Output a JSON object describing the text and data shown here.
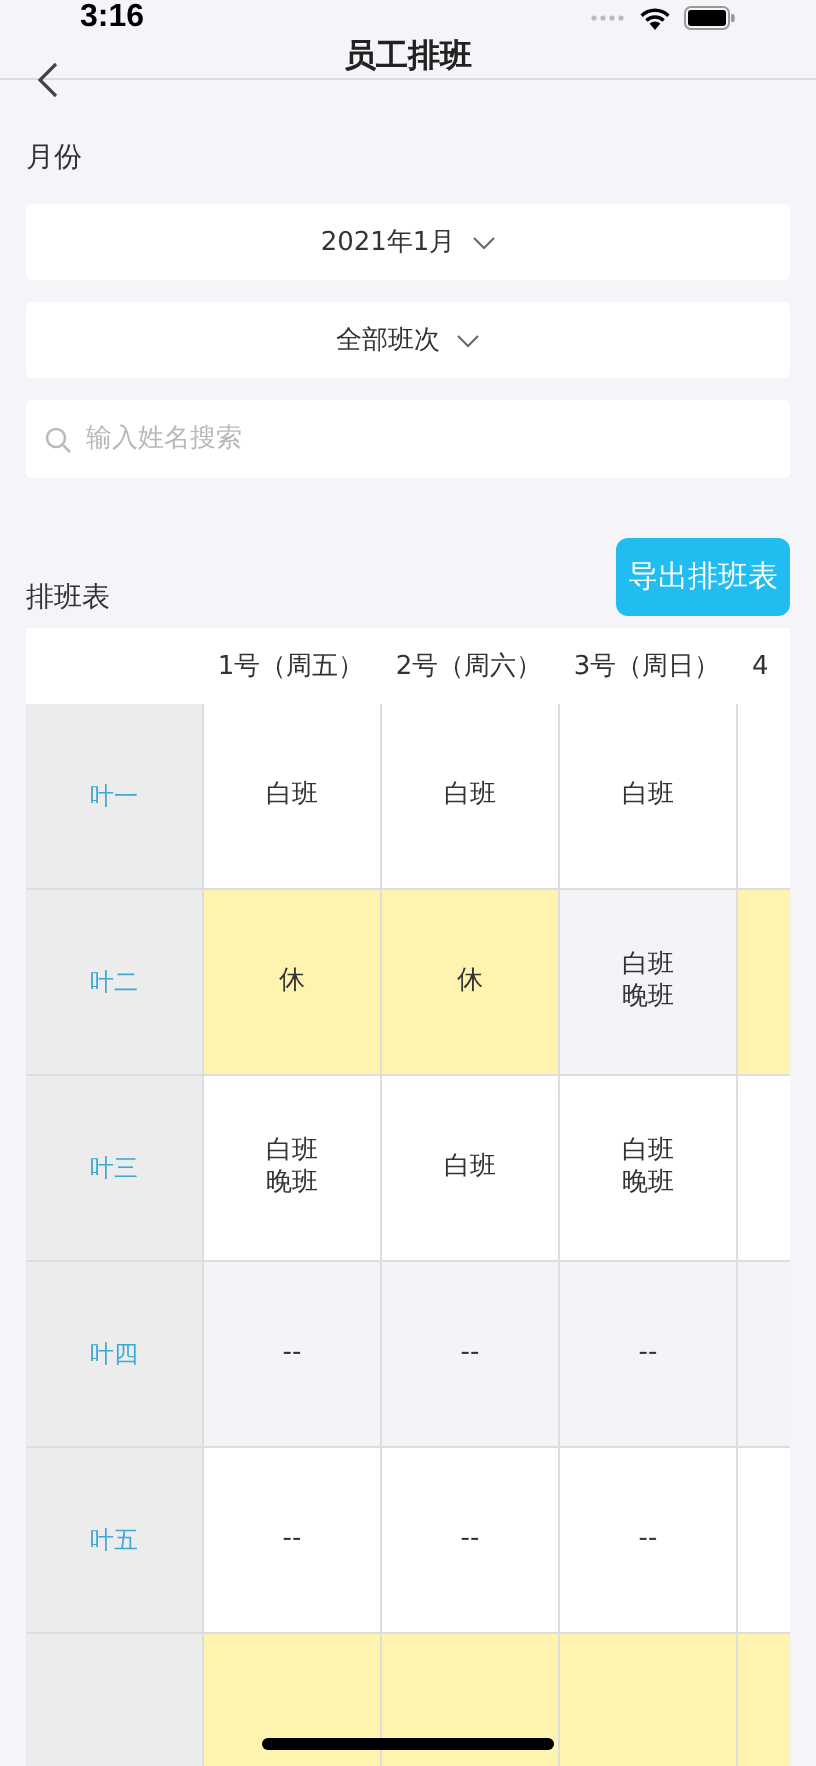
{
  "status_bar": {
    "time": "3:16"
  },
  "nav": {
    "title": "员工排班"
  },
  "month_label": "月份",
  "month_select": {
    "value": "2021年1月"
  },
  "shift_select": {
    "value": "全部班次"
  },
  "search": {
    "placeholder": "输入姓名搜索"
  },
  "schedule": {
    "title": "排班表",
    "export_button": "导出排班表",
    "columns": [
      "1号（周五）",
      "2号（周六）",
      "3号（周日）",
      "4"
    ],
    "rows": [
      {
        "name": "叶一",
        "cells": [
          {
            "lines": [
              "白班"
            ],
            "rest": false
          },
          {
            "lines": [
              "白班"
            ],
            "rest": false
          },
          {
            "lines": [
              "白班"
            ],
            "rest": false
          },
          {
            "rest": false
          }
        ]
      },
      {
        "name": "叶二",
        "cells": [
          {
            "lines": [
              "休"
            ],
            "rest": true
          },
          {
            "lines": [
              "休"
            ],
            "rest": true
          },
          {
            "lines": [
              "白班",
              "晚班"
            ],
            "rest": false
          },
          {
            "rest": true
          }
        ]
      },
      {
        "name": "叶三",
        "cells": [
          {
            "lines": [
              "白班",
              "晚班"
            ],
            "rest": false
          },
          {
            "lines": [
              "白班"
            ],
            "rest": false
          },
          {
            "lines": [
              "白班",
              "晚班"
            ],
            "rest": false
          },
          {
            "rest": false
          }
        ]
      },
      {
        "name": "叶四",
        "cells": [
          {
            "lines": [
              "--"
            ],
            "rest": false
          },
          {
            "lines": [
              "--"
            ],
            "rest": false
          },
          {
            "lines": [
              "--"
            ],
            "rest": false
          },
          {
            "rest": false
          }
        ]
      },
      {
        "name": "叶五",
        "cells": [
          {
            "lines": [
              "--"
            ],
            "rest": false
          },
          {
            "lines": [
              "--"
            ],
            "rest": false
          },
          {
            "lines": [
              "--"
            ],
            "rest": false
          },
          {
            "rest": false
          }
        ]
      },
      {
        "cells": [
          {
            "rest": true
          },
          {
            "rest": true
          },
          {
            "rest": true
          },
          {
            "rest": true
          }
        ]
      }
    ]
  }
}
